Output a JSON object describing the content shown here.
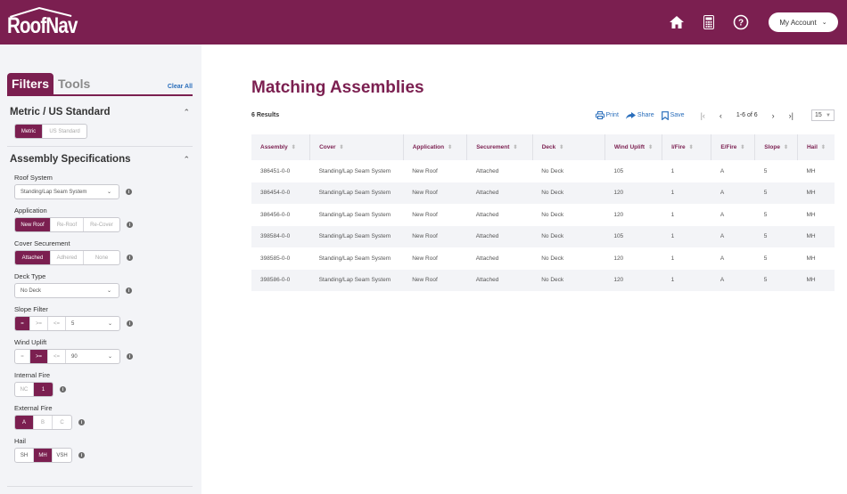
{
  "header": {
    "logo": "RoofNav",
    "account_label": "My Account",
    "icons": [
      "home-icon",
      "calculator-icon",
      "help-icon"
    ]
  },
  "sidebar": {
    "tabs": [
      {
        "label": "Filters",
        "active": true
      },
      {
        "label": "Tools",
        "active": false
      }
    ],
    "clear_all": "Clear All",
    "units": {
      "title": "Metric / US Standard",
      "options": [
        {
          "label": "Metric",
          "selected": true
        },
        {
          "label": "US Standard",
          "selected": false
        }
      ]
    },
    "assembly": {
      "title": "Assembly Specifications",
      "roof_system": {
        "label": "Roof System",
        "value": "Standing/Lap Seam System"
      },
      "application": {
        "label": "Application",
        "options": [
          {
            "label": "New Roof",
            "selected": true
          },
          {
            "label": "Re-Roof",
            "selected": false
          },
          {
            "label": "Re-Cover",
            "selected": false
          }
        ]
      },
      "cover_securement": {
        "label": "Cover Securement",
        "options": [
          {
            "label": "Attached",
            "selected": true
          },
          {
            "label": "Adhered",
            "selected": false
          },
          {
            "label": "None",
            "selected": false
          }
        ]
      },
      "deck_type": {
        "label": "Deck Type",
        "value": "No Deck"
      },
      "slope_filter": {
        "label": "Slope Filter",
        "operators": [
          {
            "label": "=",
            "selected": true
          },
          {
            "label": ">=",
            "selected": false
          },
          {
            "label": "<=",
            "selected": false
          }
        ],
        "value": "5"
      },
      "wind_uplift": {
        "label": "Wind Uplift",
        "operators": [
          {
            "label": "=",
            "selected": false
          },
          {
            "label": ">=",
            "selected": true
          },
          {
            "label": "<=",
            "selected": false
          }
        ],
        "value": "90"
      },
      "internal_fire": {
        "label": "Internal Fire",
        "options": [
          {
            "label": "NC",
            "selected": false
          },
          {
            "label": "1",
            "selected": true
          }
        ]
      },
      "external_fire": {
        "label": "External Fire",
        "options": [
          {
            "label": "A",
            "selected": true
          },
          {
            "label": "B",
            "selected": false
          },
          {
            "label": "C",
            "selected": false
          }
        ]
      },
      "hail": {
        "label": "Hail",
        "options": [
          {
            "label": "SH",
            "selected": false
          },
          {
            "label": "MH",
            "selected": true
          },
          {
            "label": "VSH",
            "selected": false
          }
        ]
      }
    }
  },
  "main": {
    "title": "Matching Assemblies",
    "results_count": "6 Results",
    "toolbar": {
      "print": "Print",
      "share": "Share",
      "save": "Save",
      "page_range": "1-6 of 6",
      "per_page": "15"
    },
    "columns": [
      "Assembly",
      "Cover",
      "Application",
      "Securement",
      "Deck",
      "Wind Uplift",
      "I/Fire",
      "E/Fire",
      "Slope",
      "Hail"
    ],
    "rows": [
      [
        "386451-0-0",
        "Standing/Lap Seam System",
        "New Roof",
        "Attached",
        "No Deck",
        "105",
        "1",
        "A",
        "5",
        "MH"
      ],
      [
        "386454-0-0",
        "Standing/Lap Seam System",
        "New Roof",
        "Attached",
        "No Deck",
        "120",
        "1",
        "A",
        "5",
        "MH"
      ],
      [
        "386456-0-0",
        "Standing/Lap Seam System",
        "New Roof",
        "Attached",
        "No Deck",
        "120",
        "1",
        "A",
        "5",
        "MH"
      ],
      [
        "398584-0-0",
        "Standing/Lap Seam System",
        "New Roof",
        "Attached",
        "No Deck",
        "105",
        "1",
        "A",
        "5",
        "MH"
      ],
      [
        "398585-0-0",
        "Standing/Lap Seam System",
        "New Roof",
        "Attached",
        "No Deck",
        "120",
        "1",
        "A",
        "5",
        "MH"
      ],
      [
        "398586-0-0",
        "Standing/Lap Seam System",
        "New Roof",
        "Attached",
        "No Deck",
        "120",
        "1",
        "A",
        "5",
        "MH"
      ]
    ]
  },
  "colors": {
    "brand": "#7b1f50",
    "link": "#2a6ebb",
    "panel": "#f3f4f7"
  }
}
